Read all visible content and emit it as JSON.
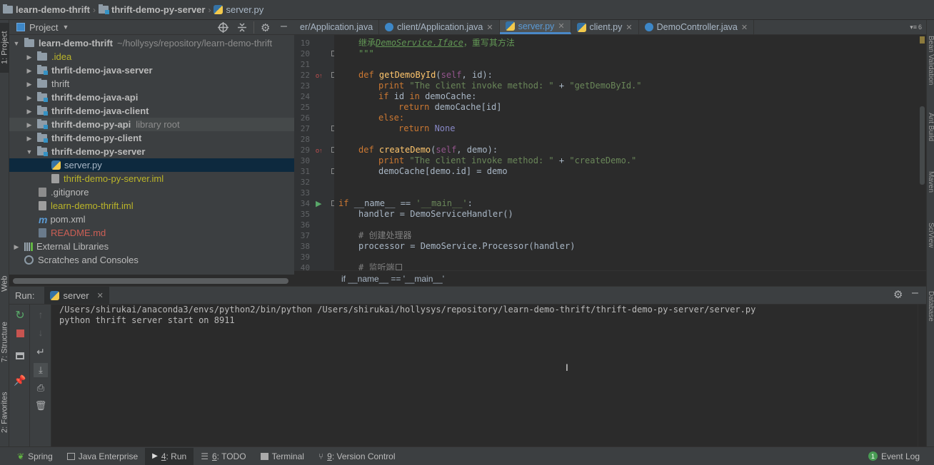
{
  "navbar": {
    "project": "learn-demo-thrift",
    "module": "thrift-demo-py-server",
    "file": "server.py"
  },
  "project_panel": {
    "title": "Project",
    "tree": [
      {
        "label": "learn-demo-thrift",
        "extra": "~/hollysys/repository/learn-demo-thrift",
        "kind": "project-root"
      },
      {
        "label": ".idea",
        "kind": "folder-yellow"
      },
      {
        "label": "thrfit-demo-java-server",
        "kind": "module"
      },
      {
        "label": "thrift",
        "kind": "folder"
      },
      {
        "label": "thrift-demo-java-api",
        "kind": "module"
      },
      {
        "label": "thrift-demo-java-client",
        "kind": "module"
      },
      {
        "label": "thrift-demo-py-api",
        "extra": "library root",
        "kind": "module-py"
      },
      {
        "label": "thrift-demo-py-client",
        "kind": "module-py"
      },
      {
        "label": "thrift-demo-py-server",
        "kind": "module-py"
      },
      {
        "label": "server.py",
        "kind": "py-file"
      },
      {
        "label": "thrift-demo-py-server.iml",
        "kind": "iml"
      },
      {
        "label": ".gitignore",
        "kind": "file"
      },
      {
        "label": "learn-demo-thrift.iml",
        "kind": "iml"
      },
      {
        "label": "pom.xml",
        "kind": "pom"
      },
      {
        "label": "README.md",
        "kind": "md"
      },
      {
        "label": "External Libraries",
        "kind": "libs"
      },
      {
        "label": "Scratches and Consoles",
        "kind": "scratches"
      }
    ]
  },
  "editor": {
    "tabs": [
      {
        "label": "er/Application.java",
        "active": false
      },
      {
        "label": "client/Application.java",
        "active": false
      },
      {
        "label": "server.py",
        "active": true
      },
      {
        "label": "client.py",
        "active": false
      },
      {
        "label": "DemoController.java",
        "active": false
      }
    ],
    "tab_overflow": "6",
    "line_numbers": [
      "19",
      "20",
      "21",
      "22",
      "23",
      "24",
      "25",
      "26",
      "27",
      "28",
      "29",
      "30",
      "31",
      "32",
      "33",
      "34",
      "35",
      "36",
      "37",
      "38",
      "39",
      "40"
    ],
    "code": {
      "l19_cn": "继承",
      "l19_cls": "DemoService.Iface",
      "l19_rest": "，重写其方法",
      "l20": "\"\"\"",
      "l22_def": "def ",
      "l22_fn": "getDemoById",
      "l22_args_a": "(",
      "l22_self": "self",
      "l22_args_b": ", id):",
      "l23_print": "print ",
      "l23_s1": "\"The client invoke method: \"",
      "l23_plus": " + ",
      "l23_s2": "\"getDemoById.\"",
      "l24_if": "if ",
      "l24_a": "id ",
      "l24_in": "in ",
      "l24_b": "demoCache:",
      "l25_ret": "return ",
      "l25_b": "demoCache[id]",
      "l26": "else:",
      "l27_ret": "return ",
      "l27_none": "None",
      "l29_def": "def ",
      "l29_fn": "createDemo",
      "l29_a": "(",
      "l29_self": "self",
      "l29_b": ", demo):",
      "l30_print": "print ",
      "l30_s1": "\"The client invoke method: \"",
      "l30_plus": " + ",
      "l30_s2": "\"createDemo.\"",
      "l31": "demoCache[demo.id] = demo",
      "l34_if": "if ",
      "l34_name": "__name__",
      "l34_eq": " == ",
      "l34_s": "'__main__'",
      "l34_c": ":",
      "l35": "handler = DemoServiceHandler()",
      "l37": "# 创建处理器",
      "l38": "processor = DemoService.Processor(handler)",
      "l40": "# 监听端口"
    },
    "breadcrumb": "if __name__ == '__main__'"
  },
  "run_panel": {
    "title": "Run:",
    "config": "server",
    "output": [
      "/Users/shirukai/anaconda3/envs/python2/bin/python /Users/shirukai/hollysys/repository/learn-demo-thrift/thrift-demo-py-server/server.py",
      "python thrift server start on 8911"
    ]
  },
  "left_strip": {
    "project_tab": "1: Project",
    "web_tab": "Web",
    "structure_tab": "7: Structure",
    "favorites_tab": "2: Favorites"
  },
  "right_strip": {
    "tabs": [
      "Bean Validation",
      "Ant Build",
      "Maven",
      "SciView",
      "Database"
    ]
  },
  "bottom_bar": {
    "items": [
      {
        "label": "Spring",
        "icon": "spring-icon"
      },
      {
        "label": "Java Enterprise",
        "icon": "java-enterprise-icon"
      },
      {
        "num": "4",
        "label": ": Run",
        "icon": "run-icon",
        "active": true
      },
      {
        "num": "6",
        "label": ": TODO",
        "icon": "todo-icon"
      },
      {
        "label": "Terminal",
        "icon": "terminal-icon"
      },
      {
        "num": "9",
        "label": ": Version Control",
        "icon": "vcs-icon"
      }
    ],
    "event_log_count": "1",
    "event_log": "Event Log"
  },
  "colors": {
    "accent": "#4a88c7",
    "selection": "#0d293e",
    "keyword": "#cc7832",
    "string": "#6a8759"
  }
}
